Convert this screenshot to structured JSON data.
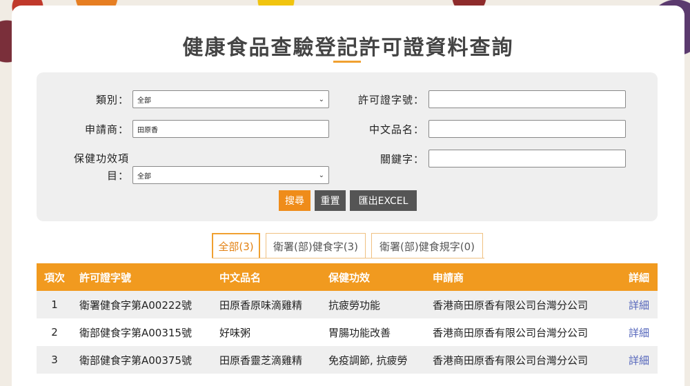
{
  "title": "健康食品查驗登記許可證資料查詢",
  "form": {
    "category_label": "類別：",
    "category_value": "全部",
    "license_label": "許可證字號：",
    "license_value": "",
    "applicant_label": "申請商：",
    "applicant_value": "田原香",
    "cname_label": "中文品名：",
    "cname_value": "",
    "health_label_1": "保健功效項",
    "health_label_2": "目：",
    "health_value": "全部",
    "keyword_label": "關鍵字：",
    "keyword_value": ""
  },
  "buttons": {
    "search": "搜尋",
    "reset": "重置",
    "excel": "匯出EXCEL"
  },
  "tabs": [
    {
      "label": "全部(3)",
      "active": true
    },
    {
      "label": "衛署(部)健食字(3)",
      "active": false
    },
    {
      "label": "衛署(部)健食規字(0)",
      "active": false
    }
  ],
  "table": {
    "headers": [
      "項次",
      "許可證字號",
      "中文品名",
      "保健功效",
      "申請商",
      "詳細"
    ],
    "rows": [
      [
        "1",
        "衛署健食字第A00222號",
        "田原香原味滴雞精",
        "抗疲勞功能",
        "香港商田原香有限公司台灣分公司",
        "詳細"
      ],
      [
        "2",
        "衛部健食字第A00315號",
        "好味粥",
        "胃腸功能改善",
        "香港商田原香有限公司台灣分公司",
        "詳細"
      ],
      [
        "3",
        "衛部健食字第A00375號",
        "田原香靈芝滴雞精",
        "免疫調節, 抗疲勞",
        "香港商田原香有限公司台灣分公司",
        "詳細"
      ]
    ]
  },
  "colors": {
    "accent": "#f19a1f",
    "button_dark": "#555555",
    "link": "#5566bb"
  }
}
